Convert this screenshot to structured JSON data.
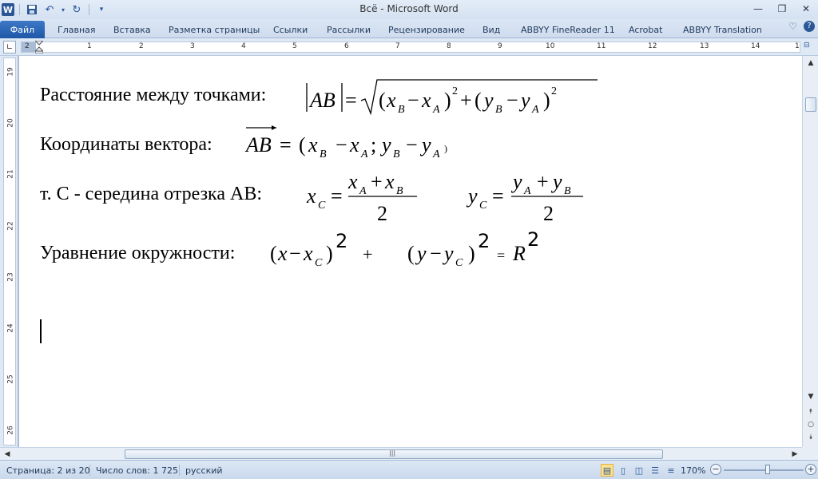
{
  "window": {
    "title": "Всё  -  Microsoft Word",
    "app_icon_letter": "W"
  },
  "qat": {
    "icons": [
      "save-icon",
      "undo-icon",
      "redo-icon",
      "customize-icon"
    ]
  },
  "ribbon": {
    "tabs": [
      {
        "label": "Файл"
      },
      {
        "label": "Главная"
      },
      {
        "label": "Вставка"
      },
      {
        "label": "Разметка страницы"
      },
      {
        "label": "Ссылки"
      },
      {
        "label": "Рассылки"
      },
      {
        "label": "Рецензирование"
      },
      {
        "label": "Вид"
      },
      {
        "label": "ABBYY FineReader 11"
      },
      {
        "label": "Acrobat"
      },
      {
        "label": "ABBYY Translation"
      }
    ]
  },
  "ruler": {
    "h_marks": [
      "2",
      "1",
      "1",
      "2",
      "3",
      "4",
      "5",
      "6",
      "7",
      "8",
      "9",
      "10",
      "11",
      "12",
      "13",
      "14",
      "15"
    ],
    "v_marks": [
      "19",
      "20",
      "21",
      "22",
      "23",
      "24",
      "25",
      "26"
    ]
  },
  "document": {
    "lines": [
      {
        "label": "Расстояние между точками:"
      },
      {
        "label": "Координаты вектора:"
      },
      {
        "label": "т. С - середина отрезка  АВ:"
      },
      {
        "label": "Уравнение окружности:"
      }
    ]
  },
  "status": {
    "page": "Страница: 2 из 20",
    "words": "Число слов: 1 725",
    "language": "русский",
    "zoom": "170%"
  },
  "colors": {
    "file_tab": "#1f57a8",
    "accent": "#2b5797"
  }
}
